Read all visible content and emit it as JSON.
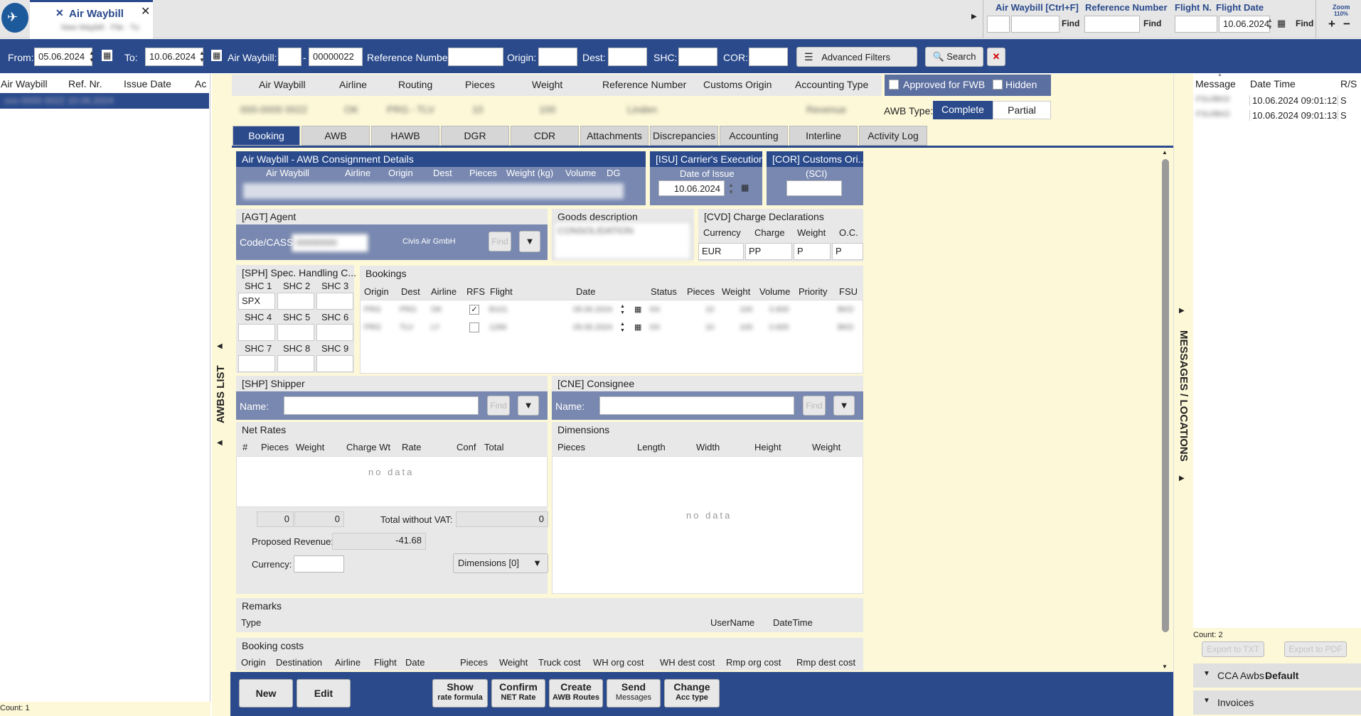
{
  "app_tab": {
    "title": "Air Waybill",
    "subtitle": "New Waybill · File · Tu"
  },
  "top_find": {
    "awb_label": "Air Waybill [Ctrl+F]",
    "ref_label": "Reference Number",
    "flight_label": "Flight N.",
    "flightdate_label": "Flight Date",
    "find1": "Find",
    "find2": "Find",
    "find3": "Find",
    "flight_date": "10.06.2024",
    "zoom_label": "Zoom",
    "zoom_value": "110%"
  },
  "filter": {
    "from_label": "From:",
    "from_value": "05.06.2024",
    "to_label": "To:",
    "to_value": "10.06.2024",
    "awb_label": "Air Waybill:",
    "awb_value": "00000022",
    "ref_label": "Reference Number",
    "origin_label": "Origin:",
    "dest_label": "Dest:",
    "shc_label": "SHC:",
    "cor_label": "COR:",
    "advanced_label": "Advanced Filters",
    "search_label": "Search"
  },
  "left_list": {
    "cols": [
      "Air Waybill",
      "Ref. Nr.",
      "Issue Date",
      "Ac"
    ],
    "row_blur": "xxx-0000 0022 10.06.2024",
    "count": "Count: 1",
    "side_label": "AWBS LIST"
  },
  "summary": {
    "cols": [
      "Air Waybill",
      "Airline",
      "Routing",
      "Pieces",
      "Weight",
      "Reference Number",
      "Customs Origin",
      "Accounting Type"
    ],
    "vals_blur": [
      "000-0000 0022",
      "OK",
      "PRG - TLV",
      "10",
      "100",
      "Linden",
      "",
      "Revenue"
    ],
    "approved_label": "Approved for FWB",
    "hidden_label": "Hidden",
    "awb_type_label": "AWB Type:",
    "type_complete": "Complete",
    "type_partial": "Partial"
  },
  "tabs": [
    "Booking",
    "AWB",
    "HAWB",
    "DGR",
    "CDR",
    "Attachments",
    "Discrepancies",
    "Accounting",
    "Interline",
    "Activity Log"
  ],
  "consignment": {
    "title": "Air Waybill - AWB Consignment Details",
    "cols": [
      "Air Waybill",
      "Airline",
      "Origin",
      "Dest",
      "Pieces",
      "Weight (kg)",
      "Volume",
      "DG"
    ],
    "isu_title": "[ISU] Carrier's Execution",
    "isu_sub": "Date of Issue",
    "isu_date": "10.06.2024",
    "cor_title": "[COR] Customs Ori...",
    "cor_sub": "(SCI)"
  },
  "agent": {
    "title": "[AGT] Agent",
    "code_label": "Code/CASS:",
    "code_blur": "00000000",
    "name": "Civis Air GmbH",
    "find": "Find"
  },
  "goods": {
    "title": "Goods description",
    "value_blur": "CONSOLIDATION"
  },
  "cvd": {
    "title": "[CVD] Charge Declarations",
    "cols": [
      "Currency",
      "Charge",
      "Weight",
      "O.C."
    ],
    "vals": [
      "EUR",
      "PP",
      "P",
      "P"
    ]
  },
  "sph": {
    "title": "[SPH] Spec. Handling C...",
    "labels": [
      "SHC 1",
      "SHC 2",
      "SHC 3",
      "SHC 4",
      "SHC 5",
      "SHC 6",
      "SHC 7",
      "SHC 8",
      "SHC 9"
    ],
    "values": [
      "SPX",
      "",
      "",
      "",
      "",
      "",
      "",
      "",
      ""
    ]
  },
  "bookings": {
    "title": "Bookings",
    "cols": [
      "Origin",
      "Dest",
      "Airline",
      "RFS",
      "Flight",
      "Date",
      "Status",
      "Pieces",
      "Weight",
      "Volume",
      "Priority",
      "FSU"
    ],
    "rows_blur": [
      [
        "PRG",
        "PRG",
        "OK",
        "",
        "B101",
        "09.06.2024",
        "KK",
        "10",
        "100",
        "0.600",
        "",
        "BKD"
      ],
      [
        "PRG",
        "TLV",
        "LY",
        "",
        "1266",
        "09.06.2024",
        "KK",
        "10",
        "100",
        "0.600",
        "",
        "BKD"
      ]
    ]
  },
  "shipper": {
    "title": "[SHP] Shipper",
    "name_label": "Name:",
    "find": "Find"
  },
  "consignee": {
    "title": "[CNE] Consignee",
    "name_label": "Name:",
    "find": "Find"
  },
  "net_rates": {
    "title": "Net Rates",
    "cols": [
      "#",
      "Pieces",
      "Weight",
      "Charge Wt",
      "Rate",
      "Conf",
      "Total"
    ],
    "no_data": "no data",
    "total_pieces": "0",
    "total_weight": "0",
    "total_vat_label": "Total without VAT:",
    "total_vat": "0",
    "proposed_label": "Proposed Revenue:",
    "proposed_value": "-41.68",
    "currency_label": "Currency:",
    "dims_label": "Dimensions [0]"
  },
  "dimensions": {
    "title": "Dimensions",
    "cols": [
      "Pieces",
      "Length",
      "Width",
      "Height",
      "Weight"
    ],
    "no_data": "no data"
  },
  "remarks": {
    "title": "Remarks",
    "cols": [
      "Type",
      "UserName",
      "DateTime"
    ]
  },
  "booking_costs": {
    "title": "Booking costs",
    "cols": [
      "Origin",
      "Destination",
      "Airline",
      "Flight",
      "Date",
      "Pieces",
      "Weight",
      "Truck cost",
      "WH org cost",
      "WH dest cost",
      "Rmp org cost",
      "Rmp dest cost"
    ]
  },
  "actions": {
    "new": "New",
    "edit": "Edit",
    "show_1": "Show",
    "show_2": "rate formula",
    "confirm_1": "Confirm",
    "confirm_2": "NET Rate",
    "create_1": "Create",
    "create_2": "AWB Routes",
    "send_1": "Send",
    "send_2": "Messages",
    "change_1": "Change",
    "change_2": "Acc type"
  },
  "messages": {
    "side_label": "MESSAGES / LOCATIONS",
    "cols": [
      "Message",
      "Date Time",
      "R/S"
    ],
    "rows": [
      {
        "msg_blur": "FSU/BKD",
        "dt": "10.06.2024 09:01:12",
        "rs": "S"
      },
      {
        "msg_blur": "FSU/BKD",
        "dt": "10.06.2024 09:01:13",
        "rs": "S"
      }
    ],
    "count": "Count: 2",
    "export_txt": "Export to TXT",
    "export_pdf": "Export to PDF"
  },
  "panels": {
    "cca_label": "CCA Awbs - ",
    "cca_value": "Default",
    "invoices": "Invoices"
  },
  "colors": {
    "navy": "#2a4a8c",
    "cream": "#fdf8d8",
    "gray_panel": "#e8e8e8",
    "accent_red": "#d00000"
  }
}
